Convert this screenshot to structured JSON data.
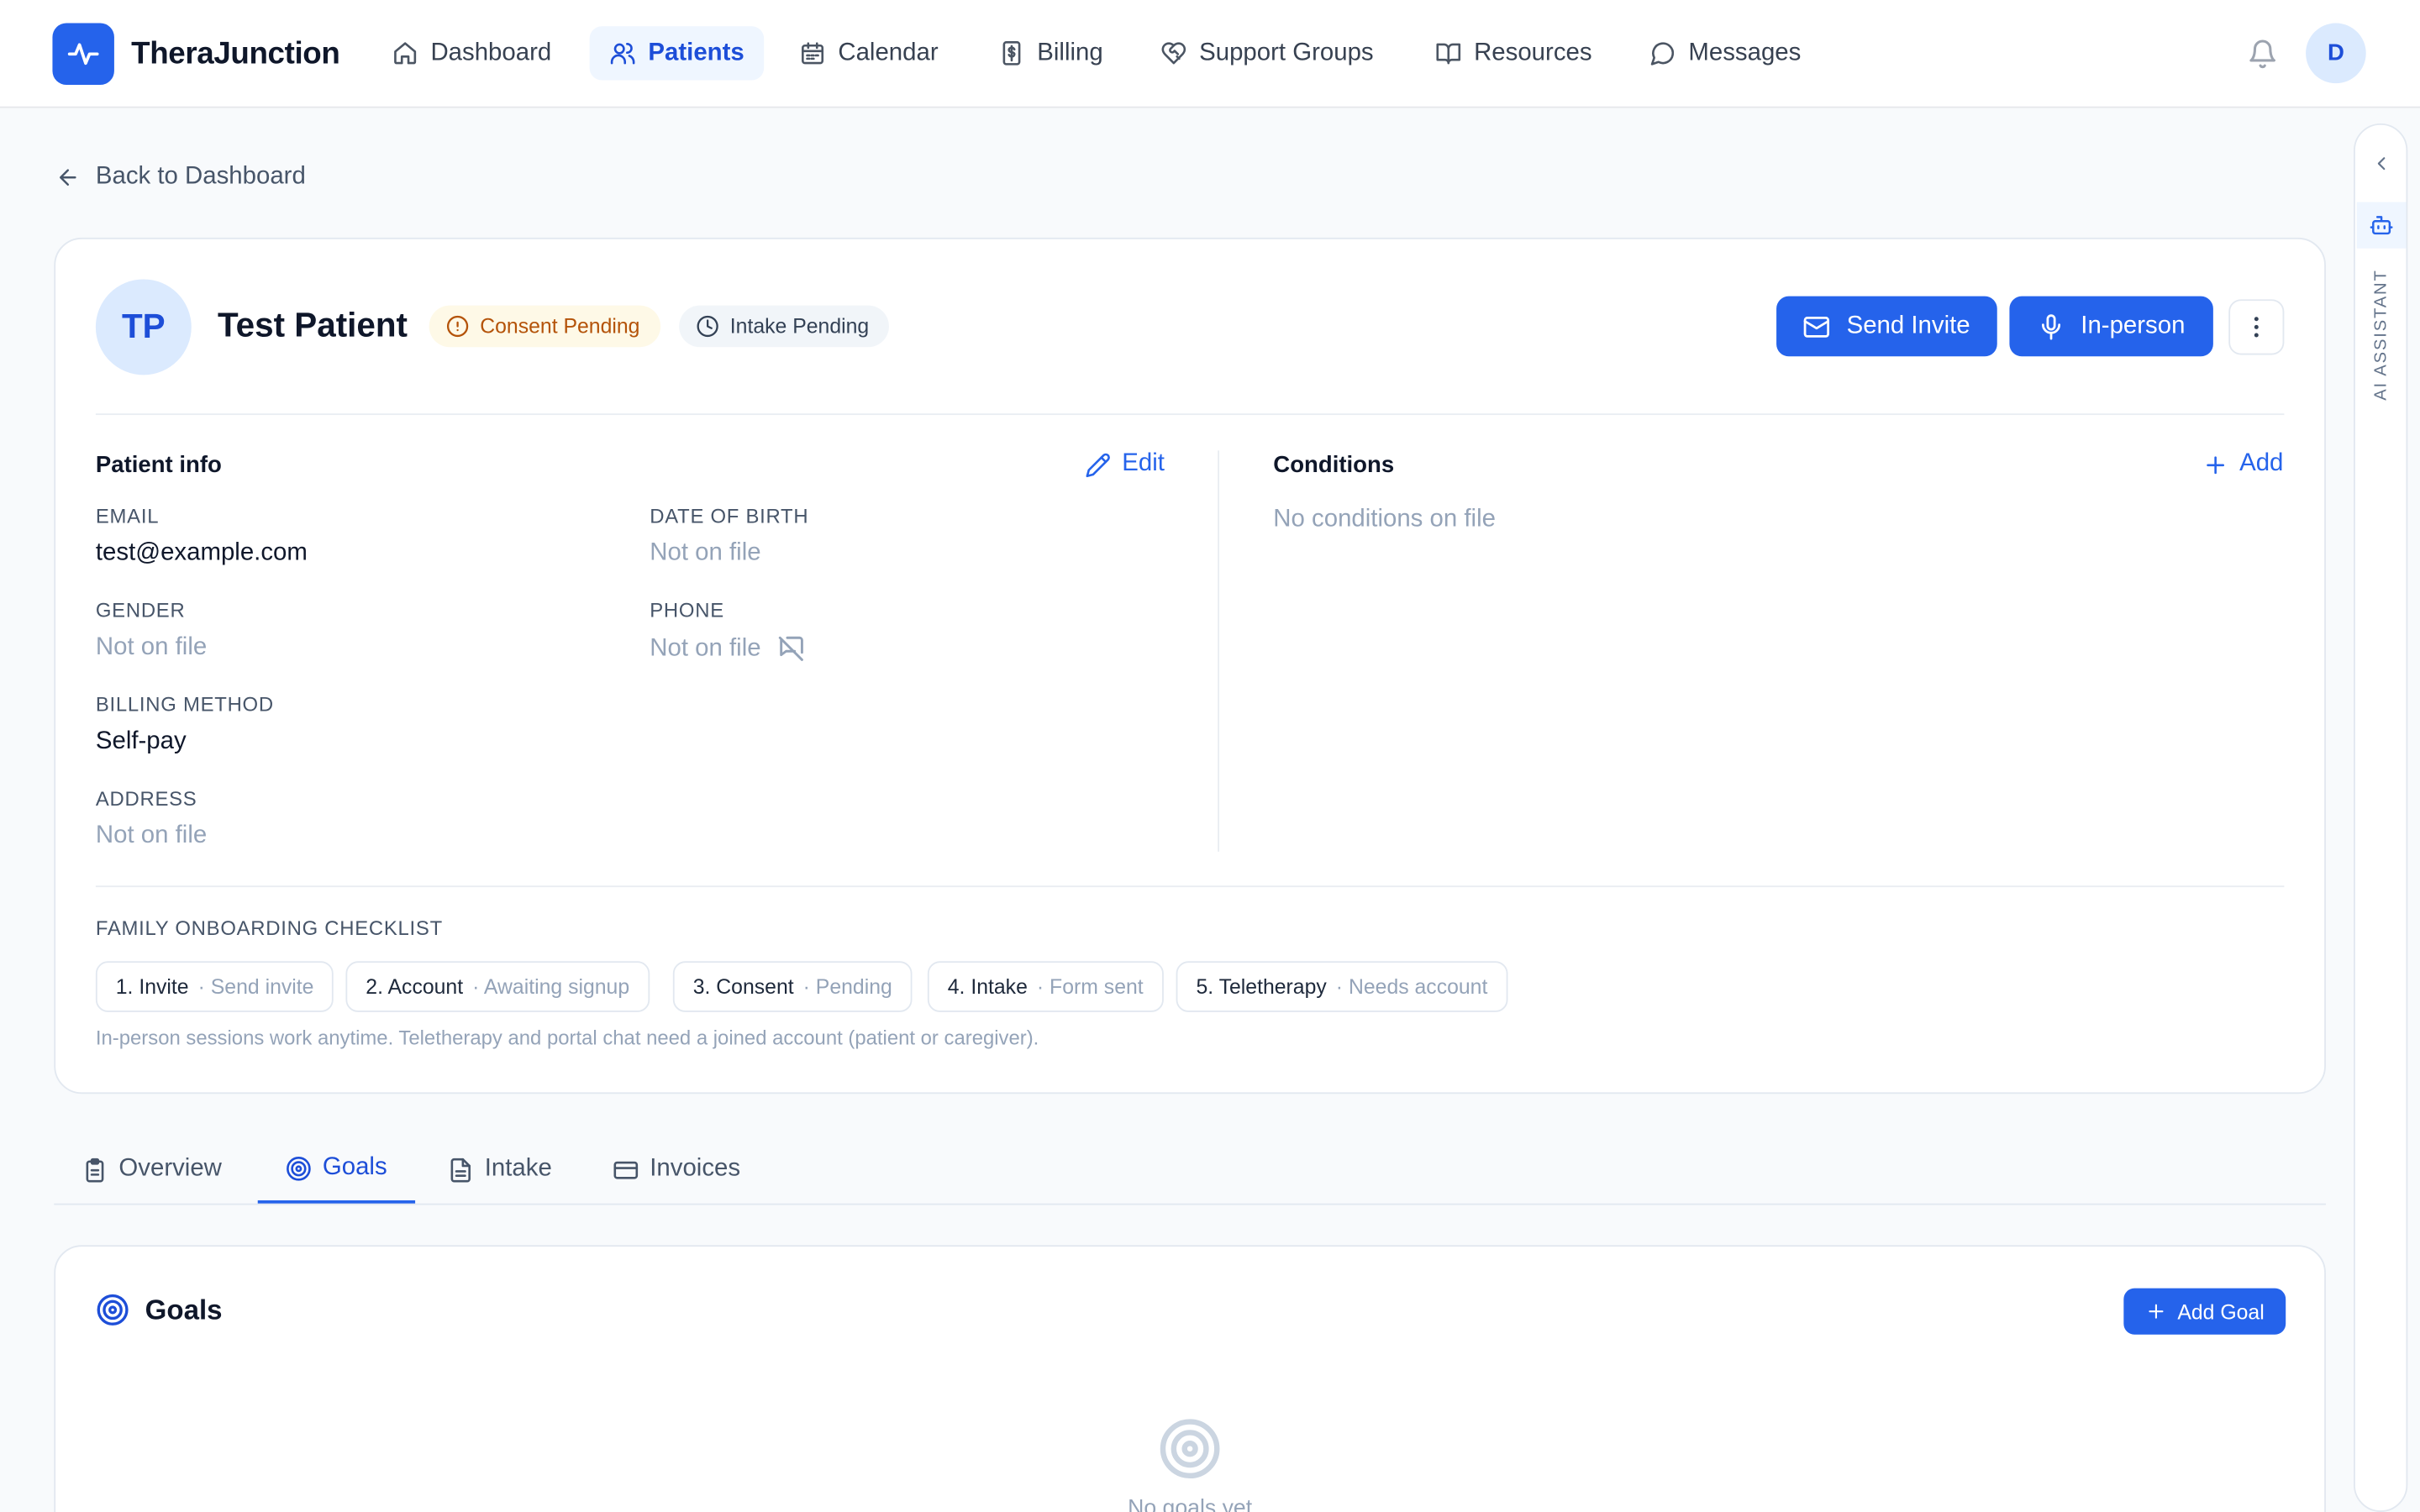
{
  "app": {
    "name": "TheraJunction",
    "user_initial": "D"
  },
  "nav": {
    "items": [
      {
        "label": "Dashboard",
        "icon": "home-icon"
      },
      {
        "label": "Patients",
        "icon": "users-icon",
        "active": true
      },
      {
        "label": "Calendar",
        "icon": "calendar-icon"
      },
      {
        "label": "Billing",
        "icon": "dollar-receipt-icon"
      },
      {
        "label": "Support Groups",
        "icon": "heart-handshake-icon"
      },
      {
        "label": "Resources",
        "icon": "book-open-icon"
      },
      {
        "label": "Messages",
        "icon": "message-circle-icon"
      }
    ]
  },
  "back_link": "Back to Dashboard",
  "patient": {
    "initials": "TP",
    "name": "Test Patient",
    "badges": {
      "consent": "Consent Pending",
      "intake": "Intake Pending"
    },
    "actions": {
      "send_invite": "Send Invite",
      "in_person": "In-person"
    }
  },
  "patient_info": {
    "title": "Patient info",
    "edit_label": "Edit",
    "fields": {
      "email": {
        "label": "EMAIL",
        "value": "test@example.com"
      },
      "dob": {
        "label": "DATE OF BIRTH",
        "value": "Not on file"
      },
      "gender": {
        "label": "GENDER",
        "value": "Not on file"
      },
      "phone": {
        "label": "PHONE",
        "value": "Not on file"
      },
      "billing": {
        "label": "BILLING METHOD",
        "value": "Self-pay"
      },
      "address": {
        "label": "ADDRESS",
        "value": "Not on file"
      }
    }
  },
  "conditions": {
    "title": "Conditions",
    "add_label": "Add",
    "empty": "No conditions on file"
  },
  "checklist": {
    "title": "FAMILY ONBOARDING CHECKLIST",
    "steps": [
      {
        "label": "1. Invite",
        "status": "· Send invite"
      },
      {
        "label": "2. Account",
        "status": "· Awaiting signup"
      },
      {
        "label": "3. Consent",
        "status": "· Pending"
      },
      {
        "label": "4. Intake",
        "status": "· Form sent"
      },
      {
        "label": "5. Teletherapy",
        "status": "· Needs account"
      }
    ],
    "hint": "In-person sessions work anytime. Teletherapy and portal chat need a joined account (patient or caregiver)."
  },
  "tabs": [
    {
      "label": "Overview",
      "icon": "clipboard-icon"
    },
    {
      "label": "Goals",
      "icon": "target-icon",
      "active": true
    },
    {
      "label": "Intake",
      "icon": "file-text-icon"
    },
    {
      "label": "Invoices",
      "icon": "credit-card-icon"
    }
  ],
  "goals": {
    "title": "Goals",
    "add_label": "Add Goal",
    "empty": "No goals yet"
  },
  "ai_panel": {
    "label": "AI ASSISTANT"
  },
  "colors": {
    "primary": "#2563eb",
    "primary_dark": "#1d4ed8",
    "warning_bg": "#fef9e7",
    "warning_text": "#b45309"
  }
}
